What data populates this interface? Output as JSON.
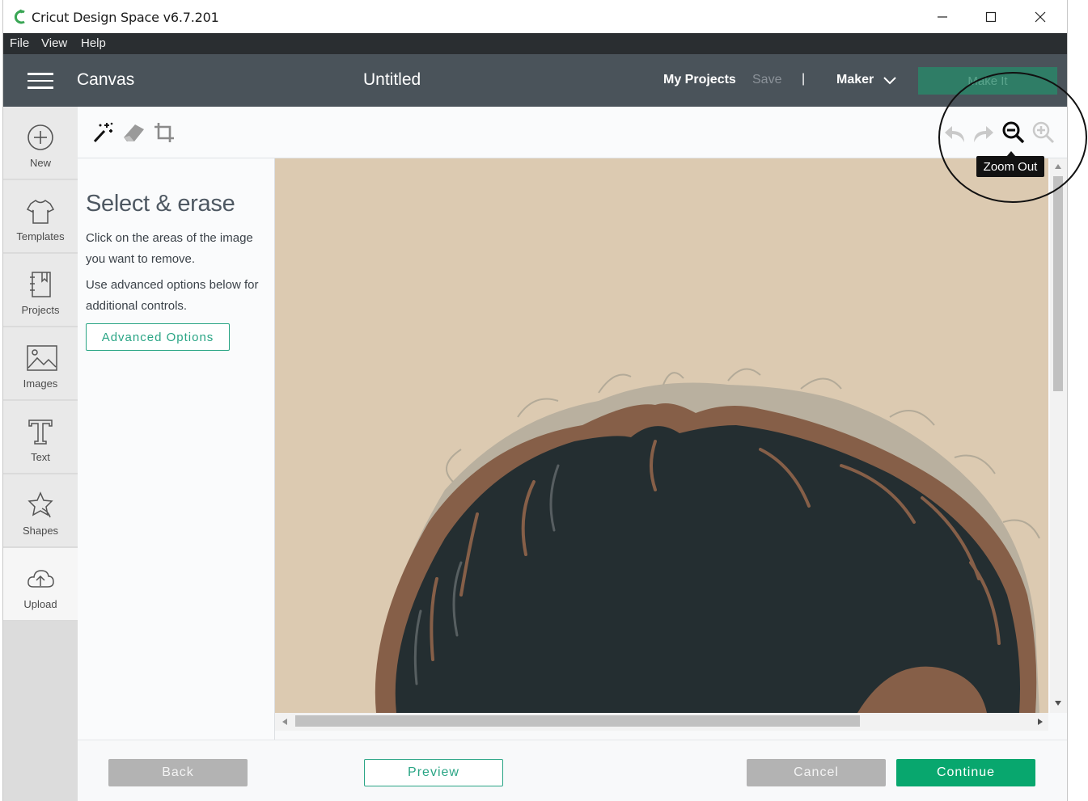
{
  "window": {
    "title": "Cricut Design Space  v6.7.201"
  },
  "menu": {
    "items": [
      "File",
      "View",
      "Help"
    ]
  },
  "header": {
    "section": "Canvas",
    "document_title": "Untitled",
    "my_projects": "My Projects",
    "save": "Save",
    "separator": "|",
    "machine": "Maker",
    "make_it": "Make It"
  },
  "sidebar": {
    "items": [
      {
        "label": "New",
        "icon": "plus-circle-icon"
      },
      {
        "label": "Templates",
        "icon": "shirt-icon"
      },
      {
        "label": "Projects",
        "icon": "notebook-icon"
      },
      {
        "label": "Images",
        "icon": "image-icon"
      },
      {
        "label": "Text",
        "icon": "text-icon"
      },
      {
        "label": "Shapes",
        "icon": "shapes-icon"
      },
      {
        "label": "Upload",
        "icon": "cloud-upload-icon",
        "active": true
      }
    ]
  },
  "toolbar": {
    "tools": [
      "magic-wand-icon",
      "eraser-icon",
      "crop-icon"
    ],
    "right_tools": [
      "undo-icon",
      "redo-icon",
      "zoom-out-icon",
      "zoom-in-icon"
    ],
    "tooltip": "Zoom Out"
  },
  "panel": {
    "title": "Select & erase",
    "text1": "Click on the areas of the image you want to remove.",
    "text2": "Use advanced options below for additional controls.",
    "advanced_button": "Advanced Options"
  },
  "footer": {
    "back": "Back",
    "preview": "Preview",
    "cancel": "Cancel",
    "continue": "Continue"
  },
  "colors": {
    "accent": "#2aa585",
    "continue": "#08a76e",
    "appbar": "#4a535a",
    "menubar": "#2a2e31",
    "image_background": "#dccab1",
    "hair_dark": "#242e31",
    "hair_brown": "#865f48",
    "hair_light": "#b3aa98"
  }
}
